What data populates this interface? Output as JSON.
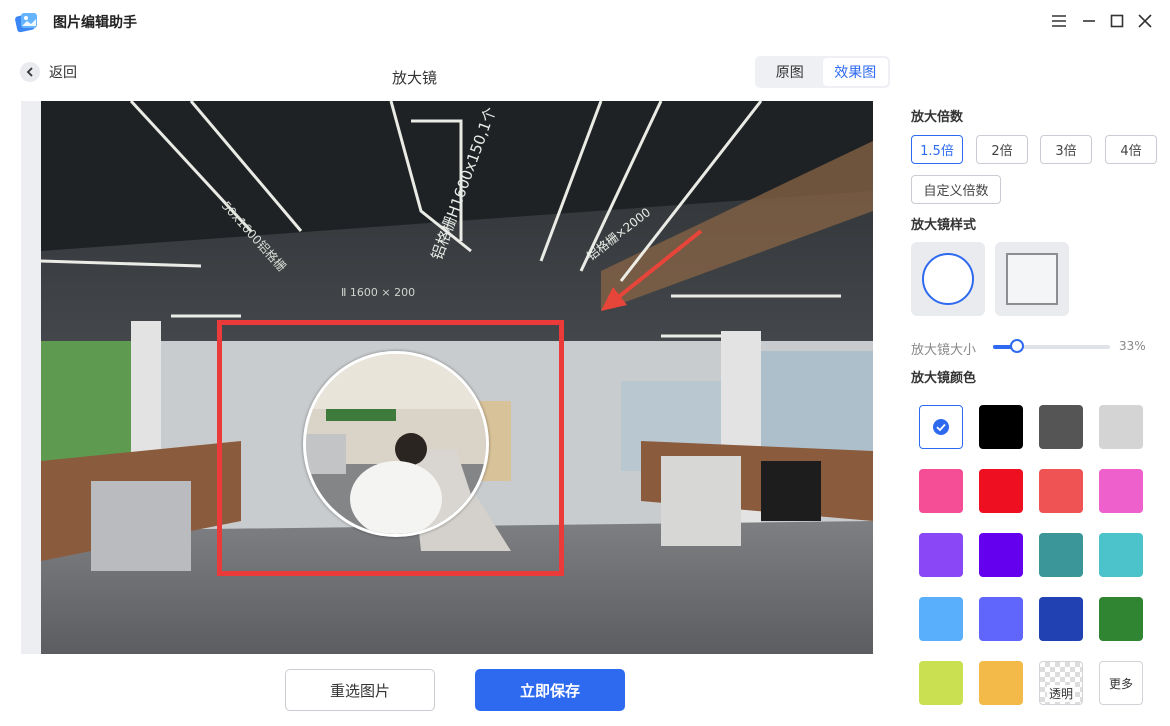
{
  "app": {
    "title": "图片编辑助手"
  },
  "nav": {
    "back_label": "返回",
    "page_title": "放大镜"
  },
  "view_toggle": {
    "original_label": "原图",
    "effect_label": "效果图",
    "active": "效果图"
  },
  "photo": {
    "wall_text_1": "铝格栅H1600x150,1个",
    "wall_text_2": "Ⅱ 1600 × 200",
    "wall_text_3": "铝格栅×2000",
    "wall_text_4": "50x1600铝格栅"
  },
  "panel": {
    "zoom_title": "放大倍数",
    "zoom_options": [
      "1.5倍",
      "2倍",
      "3倍",
      "4倍"
    ],
    "zoom_selected": "1.5倍",
    "custom_zoom_label": "自定义倍数",
    "style_title": "放大镜样式",
    "styles": [
      "circle",
      "square"
    ],
    "style_selected": "circle",
    "size_label": "放大镜大小",
    "size_value": "33%",
    "size_fraction": 0.33,
    "color_title": "放大镜颜色",
    "colors": [
      "#2e6af0",
      "#000000",
      "#555555",
      "#d4d4d4",
      "#f54e97",
      "#ee1020",
      "#ef5353",
      "#ee60cc",
      "#8a47f5",
      "#6500ee",
      "#3a9699",
      "#4cc3ca",
      "#5aaffc",
      "#6066fb",
      "#2141b2",
      "#2f8532",
      "#cbe050",
      "#f3ba4a"
    ],
    "selected_color_index": 0,
    "transparent_label": "透明",
    "more_label": "更多",
    "icons": {
      "selected": "check-icon"
    }
  },
  "footer": {
    "reselect_label": "重选图片",
    "save_label": "立即保存"
  },
  "colors": {
    "accent": "#2e6af0",
    "highlight_rect": "#ea3a3a",
    "arrow": "#e8453a"
  }
}
